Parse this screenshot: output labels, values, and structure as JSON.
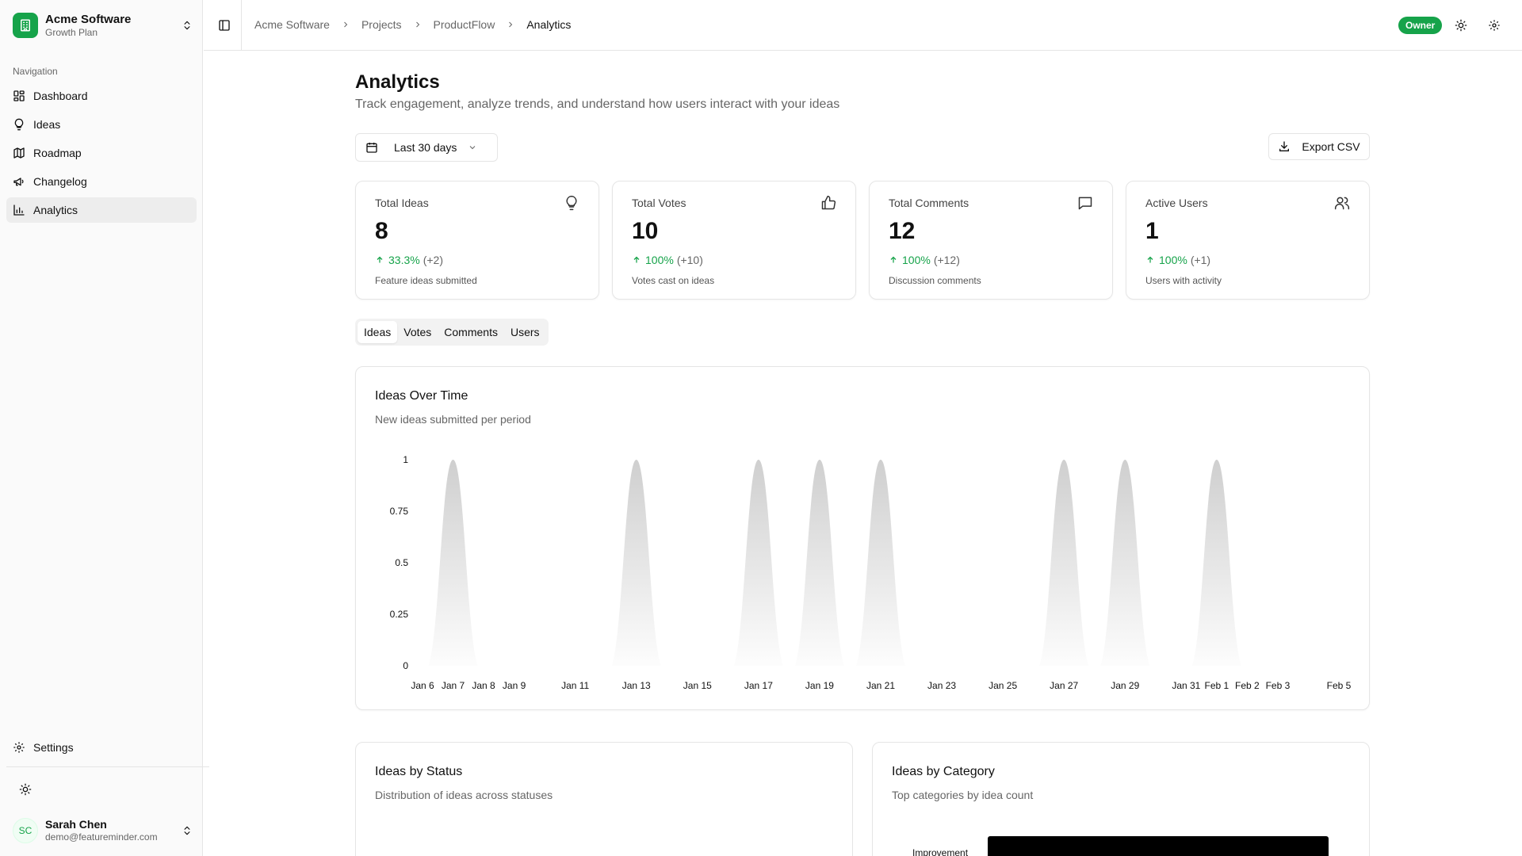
{
  "org": {
    "name": "Acme Software",
    "plan": "Growth Plan"
  },
  "sidebar": {
    "section_label": "Navigation",
    "items": [
      {
        "label": "Dashboard",
        "icon": "dashboard-icon"
      },
      {
        "label": "Ideas",
        "icon": "lightbulb-icon"
      },
      {
        "label": "Roadmap",
        "icon": "map-icon"
      },
      {
        "label": "Changelog",
        "icon": "megaphone-icon"
      },
      {
        "label": "Analytics",
        "icon": "bar-chart-icon",
        "active": true
      }
    ],
    "settings_label": "Settings"
  },
  "user": {
    "initials": "SC",
    "name": "Sarah Chen",
    "email": "demo@featureminder.com"
  },
  "breadcrumb": [
    "Acme Software",
    "Projects",
    "ProductFlow",
    "Analytics"
  ],
  "header": {
    "role_badge": "Owner"
  },
  "page": {
    "title": "Analytics",
    "subtitle": "Track engagement, analyze trends, and understand how users interact with your ideas",
    "date_range": "Last 30 days",
    "export_label": "Export CSV"
  },
  "stats": [
    {
      "title": "Total Ideas",
      "value": "8",
      "pct": "33.3%",
      "abs": "(+2)",
      "desc": "Feature ideas submitted",
      "icon": "lightbulb-icon"
    },
    {
      "title": "Total Votes",
      "value": "10",
      "pct": "100%",
      "abs": "(+10)",
      "desc": "Votes cast on ideas",
      "icon": "thumbs-up-icon"
    },
    {
      "title": "Total Comments",
      "value": "12",
      "pct": "100%",
      "abs": "(+12)",
      "desc": "Discussion comments",
      "icon": "message-icon"
    },
    {
      "title": "Active Users",
      "value": "1",
      "pct": "100%",
      "abs": "(+1)",
      "desc": "Users with activity",
      "icon": "users-icon"
    }
  ],
  "tabs": [
    "Ideas",
    "Votes",
    "Comments",
    "Users"
  ],
  "active_tab": "Ideas",
  "colors": {
    "accent": "#16a34a",
    "peak": "#d4d4d4"
  },
  "chart_data": {
    "type": "area",
    "title": "Ideas Over Time",
    "subtitle": "New ideas submitted per period",
    "x": [
      "Jan 6",
      "Jan 7",
      "Jan 8",
      "Jan 9",
      "Jan 11",
      "Jan 13",
      "Jan 15",
      "Jan 17",
      "Jan 19",
      "Jan 21",
      "Jan 23",
      "Jan 25",
      "Jan 27",
      "Jan 29",
      "Jan 31",
      "Feb 1",
      "Feb 2",
      "Feb 3",
      "Feb 5"
    ],
    "values": [
      0,
      1,
      0,
      0,
      0,
      1,
      0,
      1,
      1,
      1,
      0,
      0,
      1,
      1,
      0,
      1,
      0,
      0,
      0
    ],
    "yticks": [
      "0",
      "0.25",
      "0.5",
      "0.75",
      "1"
    ],
    "ylim": [
      0,
      1
    ],
    "grid": false
  },
  "lower": {
    "status": {
      "title": "Ideas by Status",
      "subtitle": "Distribution of ideas across statuses"
    },
    "category": {
      "title": "Ideas by Category",
      "subtitle": "Top categories by idea count",
      "first_label": "Improvement"
    }
  }
}
